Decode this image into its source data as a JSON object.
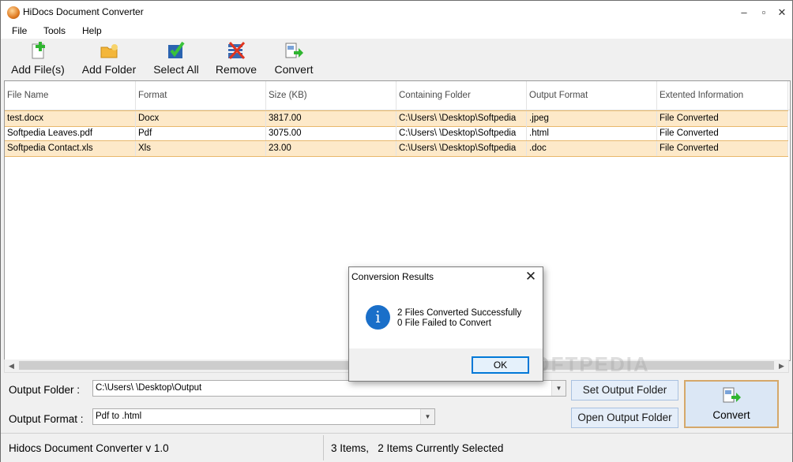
{
  "window": {
    "title": "HiDocs Document Converter",
    "minimize": "–",
    "maximize": "▫",
    "close": "✕"
  },
  "menu": {
    "items": [
      "File",
      "Tools",
      "Help"
    ]
  },
  "toolbar": {
    "add_files": "Add File(s)",
    "add_folder": "Add Folder",
    "select_all": "Select All",
    "remove": "Remove",
    "convert": "Convert"
  },
  "table": {
    "columns": [
      "File Name",
      "Format",
      "Size (KB)",
      "Containing Folder",
      "Output Format",
      "Extented Information"
    ],
    "rows": [
      [
        "test.docx",
        "Docx",
        "3817.00",
        "C:\\Users\\  \\Desktop\\Softpedia",
        ".jpeg",
        "File Converted"
      ],
      [
        "Softpedia Leaves.pdf",
        "Pdf",
        "3075.00",
        "C:\\Users\\  \\Desktop\\Softpedia",
        ".html",
        "File Converted"
      ],
      [
        "Softpedia Contact.xls",
        "Xls",
        "23.00",
        "C:\\Users\\  \\Desktop\\Softpedia",
        ".doc",
        "File Converted"
      ]
    ]
  },
  "output": {
    "folder_label": "Output Folder :",
    "folder_value": "C:\\Users\\  \\Desktop\\Output",
    "format_label": "Output Format :",
    "format_value": "Pdf to .html",
    "set_folder": "Set Output Folder",
    "open_folder": "Open Output Folder",
    "convert": "Convert"
  },
  "status": {
    "version": "Hidocs Document Converter v 1.0",
    "selection": "3 Items,   2 Items Currently Selected"
  },
  "dialog": {
    "title": "Conversion Results",
    "line1": "2 Files Converted Successfully",
    "line2": "0 File Failed to Convert",
    "ok": "OK",
    "info_glyph": "i"
  },
  "watermark": "SOFTPEDIA",
  "colors": {
    "selected_row": "#fde9c9",
    "info_blue": "#1a6fc9",
    "accent_border": "#d5a86a"
  }
}
